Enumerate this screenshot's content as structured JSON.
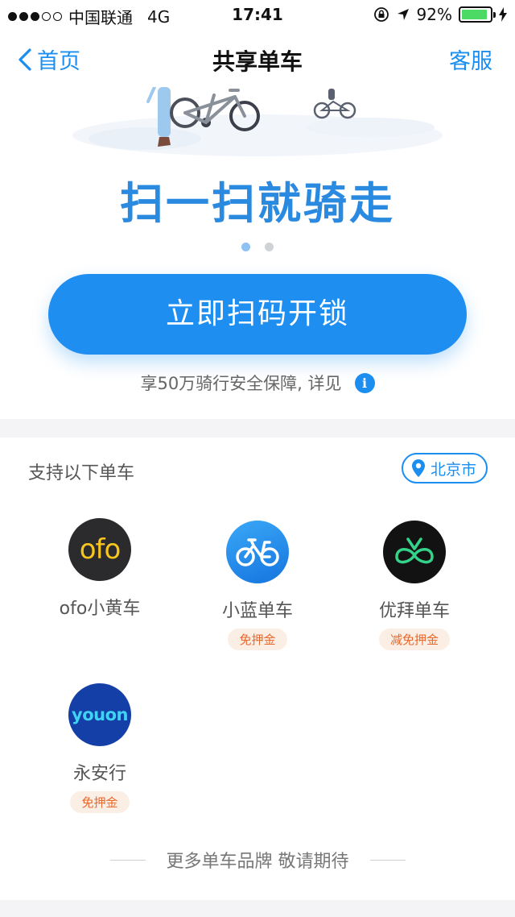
{
  "status_bar": {
    "carrier": "中国联通",
    "network": "4G",
    "time": "17:41",
    "battery": "92%",
    "battery_level": 0.92
  },
  "nav": {
    "back_label": "首页",
    "title": "共享单车",
    "right_label": "客服"
  },
  "hero": {
    "slogan": "扫一扫就骑走",
    "page_count": 2,
    "active_page": 1,
    "scan_button": "立即扫码开锁",
    "insurance_text": "享50万骑行安全保障, 详见"
  },
  "brands": {
    "section_title": "支持以下单车",
    "city": "北京市",
    "items": [
      {
        "name": "ofo小黄车",
        "logo_text": "ofo",
        "tag": ""
      },
      {
        "name": "小蓝单车",
        "logo_text": "",
        "tag": "免押金"
      },
      {
        "name": "优拜单车",
        "logo_text": "",
        "tag": "减免押金"
      },
      {
        "name": "永安行",
        "logo_text": "youon",
        "tag": "免押金"
      }
    ],
    "more_text": "更多单车品牌 敬请期待"
  },
  "colors": {
    "accent": "#1b8ef0",
    "tag_bg": "#fbeee4",
    "tag_text": "#e8682c",
    "ofo_yellow": "#f7c51e",
    "bluegogo": "#1d8bea",
    "ubike_green": "#35d38a",
    "youon_blue": "#133fa6"
  }
}
